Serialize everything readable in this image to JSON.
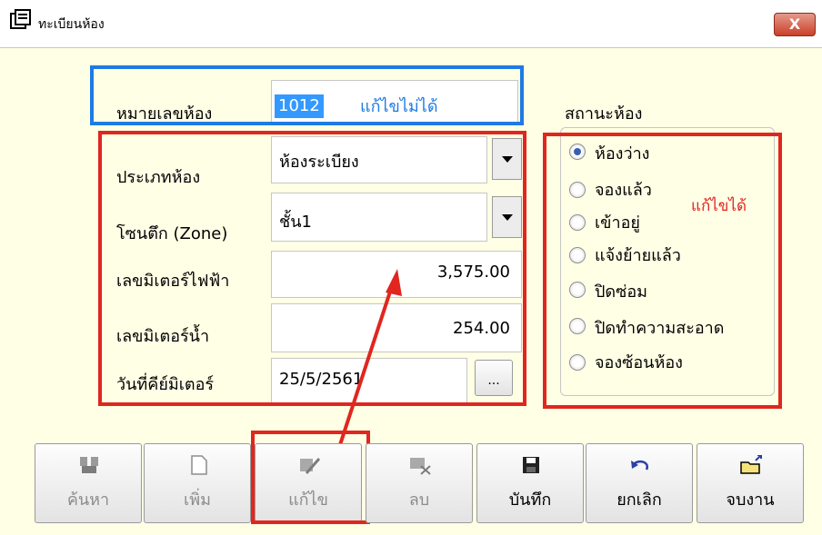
{
  "window": {
    "title": "ทะเบียนห้อง",
    "close_label": "X"
  },
  "form": {
    "room_number_label": "หมายเลขห้อง",
    "room_number_value": "1012",
    "room_type_label": "ประเภทห้อง",
    "room_type_value": "ห้องระเบียง",
    "zone_label": "โซนตึก (Zone)",
    "zone_value": "ชั้น1",
    "electric_meter_label": "เลขมิเตอร์ไฟฟ้า",
    "electric_meter_value": "3,575.00",
    "water_meter_label": "เลขมิเตอร์น้ำ",
    "water_meter_value": "254.00",
    "meter_date_label": "วันที่คีย์มิเตอร์",
    "meter_date_value": "25/5/2561",
    "date_button_label": "..."
  },
  "status": {
    "heading": "สถานะห้อง",
    "options": [
      "ห้องว่าง",
      "จองแล้ว",
      "เข้าอยู่",
      "แจ้งย้ายแล้ว",
      "ปิดซ่อม",
      "ปิดทำความสะอาด",
      "จองซ้อนห้อง"
    ],
    "selected": "ห้องว่าง"
  },
  "annotations": {
    "not_editable": "แก้ไขไม่ได้",
    "editable": "แก้ไขได้"
  },
  "toolbar": {
    "search": "ค้นหา",
    "add": "เพิ่ม",
    "edit": "แก้ไข",
    "delete": "ลบ",
    "save": "บันทึก",
    "cancel": "ยกเลิก",
    "exit": "จบงาน"
  },
  "colors": {
    "annotation_blue": "#1e7be3",
    "annotation_red": "#e0261f",
    "selection_blue": "#3399ff",
    "background": "#ffffe6"
  }
}
